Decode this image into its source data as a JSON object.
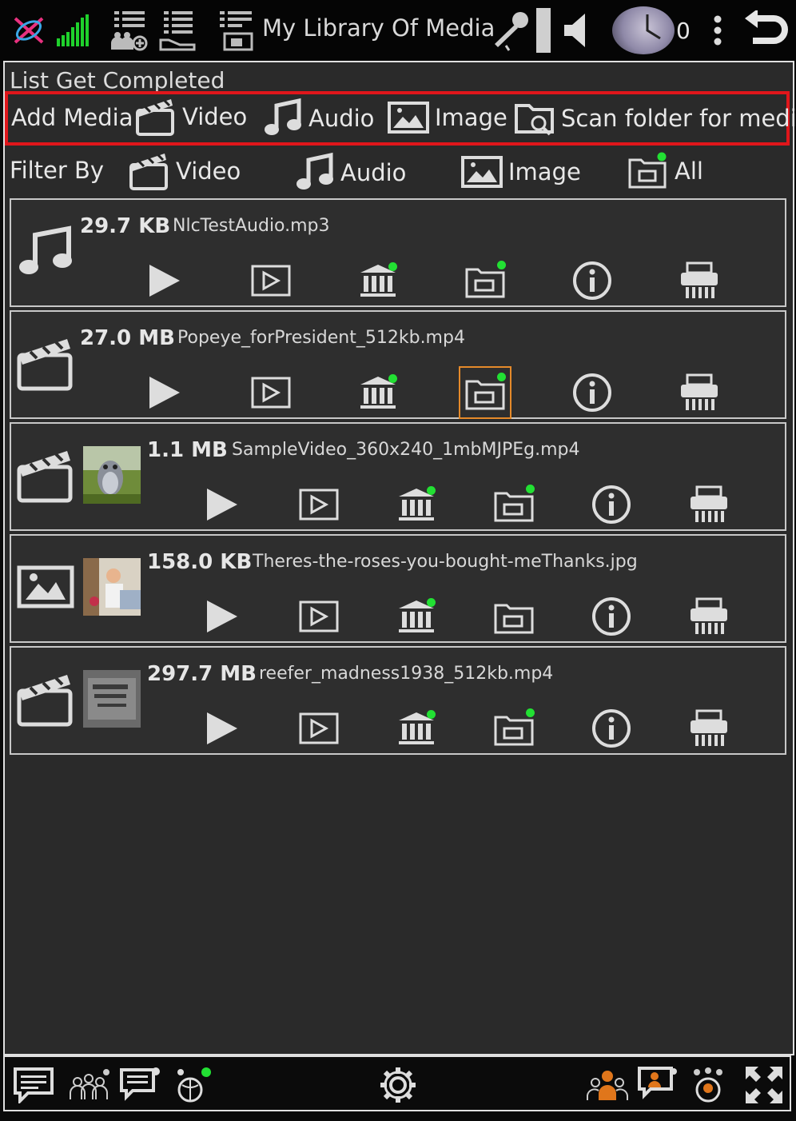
{
  "app": {
    "title": "My Library Of Media",
    "counter": "0"
  },
  "status": "List Get Completed",
  "add_media": {
    "label": "Add Media",
    "video": "Video",
    "audio": "Audio",
    "image": "Image",
    "scan": "Scan folder for media"
  },
  "filter": {
    "label": "Filter By",
    "video": "Video",
    "audio": "Audio",
    "image": "Image",
    "all": "All"
  },
  "media": [
    {
      "type": "audio",
      "size": "29.7 KB",
      "name": "NlcTestAudio.mp3"
    },
    {
      "type": "video",
      "size": "27.0 MB",
      "name": "Popeye_forPresident_512kb.mp4"
    },
    {
      "type": "video",
      "size": "1.1 MB",
      "name": "SampleVideo_360x240_1mbMJPEg.mp4"
    },
    {
      "type": "image",
      "size": "158.0 KB",
      "name": "Theres-the-roses-you-bought-meThanks.jpg"
    },
    {
      "type": "video",
      "size": "297.7 MB",
      "name": "reefer_madness1938_512kb.mp4"
    }
  ],
  "colors": {
    "accent": "#e0161b",
    "selection": "#e58a2a",
    "online": "#22e033",
    "signal": "#1fd12c"
  }
}
